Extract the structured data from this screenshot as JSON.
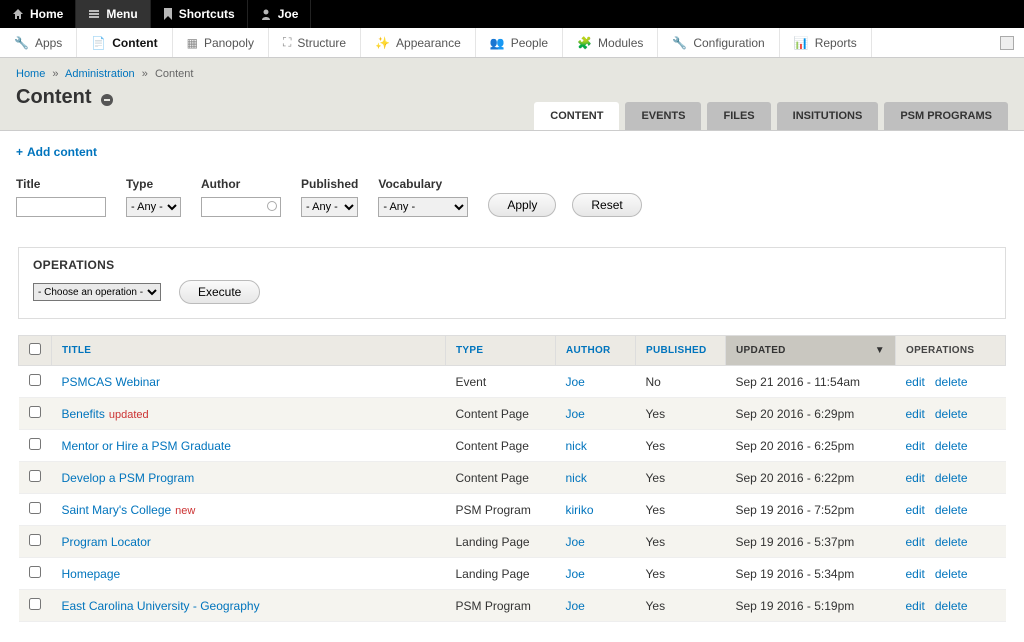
{
  "topbar": {
    "home": "Home",
    "menu": "Menu",
    "shortcuts": "Shortcuts",
    "user": "Joe"
  },
  "adminmenu": {
    "apps": "Apps",
    "content": "Content",
    "panopoly": "Panopoly",
    "structure": "Structure",
    "appearance": "Appearance",
    "people": "People",
    "modules": "Modules",
    "configuration": "Configuration",
    "reports": "Reports"
  },
  "breadcrumb": {
    "home": "Home",
    "administration": "Administration",
    "current": "Content"
  },
  "page_title": "Content",
  "tabs": {
    "content": "CONTENT",
    "events": "EVENTS",
    "files": "FILES",
    "institutions": "INSITUTIONS",
    "programs": "PSM PROGRAMS"
  },
  "add_link": "Add content",
  "filters": {
    "title_label": "Title",
    "type_label": "Type",
    "author_label": "Author",
    "published_label": "Published",
    "vocabulary_label": "Vocabulary",
    "any": "- Any -",
    "apply": "Apply",
    "reset": "Reset"
  },
  "ops_box": {
    "heading": "OPERATIONS",
    "choose": "- Choose an operation -",
    "execute": "Execute"
  },
  "table": {
    "headers": {
      "title": "TITLE",
      "type": "TYPE",
      "author": "AUTHOR",
      "published": "PUBLISHED",
      "updated": "UPDATED",
      "operations": "OPERATIONS"
    },
    "edit": "edit",
    "delete": "delete",
    "rows": [
      {
        "title": "PSMCAS Webinar",
        "mark": "",
        "type": "Event",
        "author": "Joe",
        "published": "No",
        "updated": "Sep 21 2016 - 11:54am"
      },
      {
        "title": "Benefits",
        "mark": "updated",
        "type": "Content Page",
        "author": "Joe",
        "published": "Yes",
        "updated": "Sep 20 2016 - 6:29pm"
      },
      {
        "title": "Mentor or Hire a PSM Graduate",
        "mark": "",
        "type": "Content Page",
        "author": "nick",
        "published": "Yes",
        "updated": "Sep 20 2016 - 6:25pm"
      },
      {
        "title": "Develop a PSM Program",
        "mark": "",
        "type": "Content Page",
        "author": "nick",
        "published": "Yes",
        "updated": "Sep 20 2016 - 6:22pm"
      },
      {
        "title": "Saint Mary's College",
        "mark": "new",
        "type": "PSM Program",
        "author": "kiriko",
        "published": "Yes",
        "updated": "Sep 19 2016 - 7:52pm"
      },
      {
        "title": "Program Locator",
        "mark": "",
        "type": "Landing Page",
        "author": "Joe",
        "published": "Yes",
        "updated": "Sep 19 2016 - 5:37pm"
      },
      {
        "title": "Homepage",
        "mark": "",
        "type": "Landing Page",
        "author": "Joe",
        "published": "Yes",
        "updated": "Sep 19 2016 - 5:34pm"
      },
      {
        "title": "East Carolina University - Geography",
        "mark": "",
        "type": "PSM Program",
        "author": "Joe",
        "published": "Yes",
        "updated": "Sep 19 2016 - 5:19pm"
      }
    ]
  }
}
